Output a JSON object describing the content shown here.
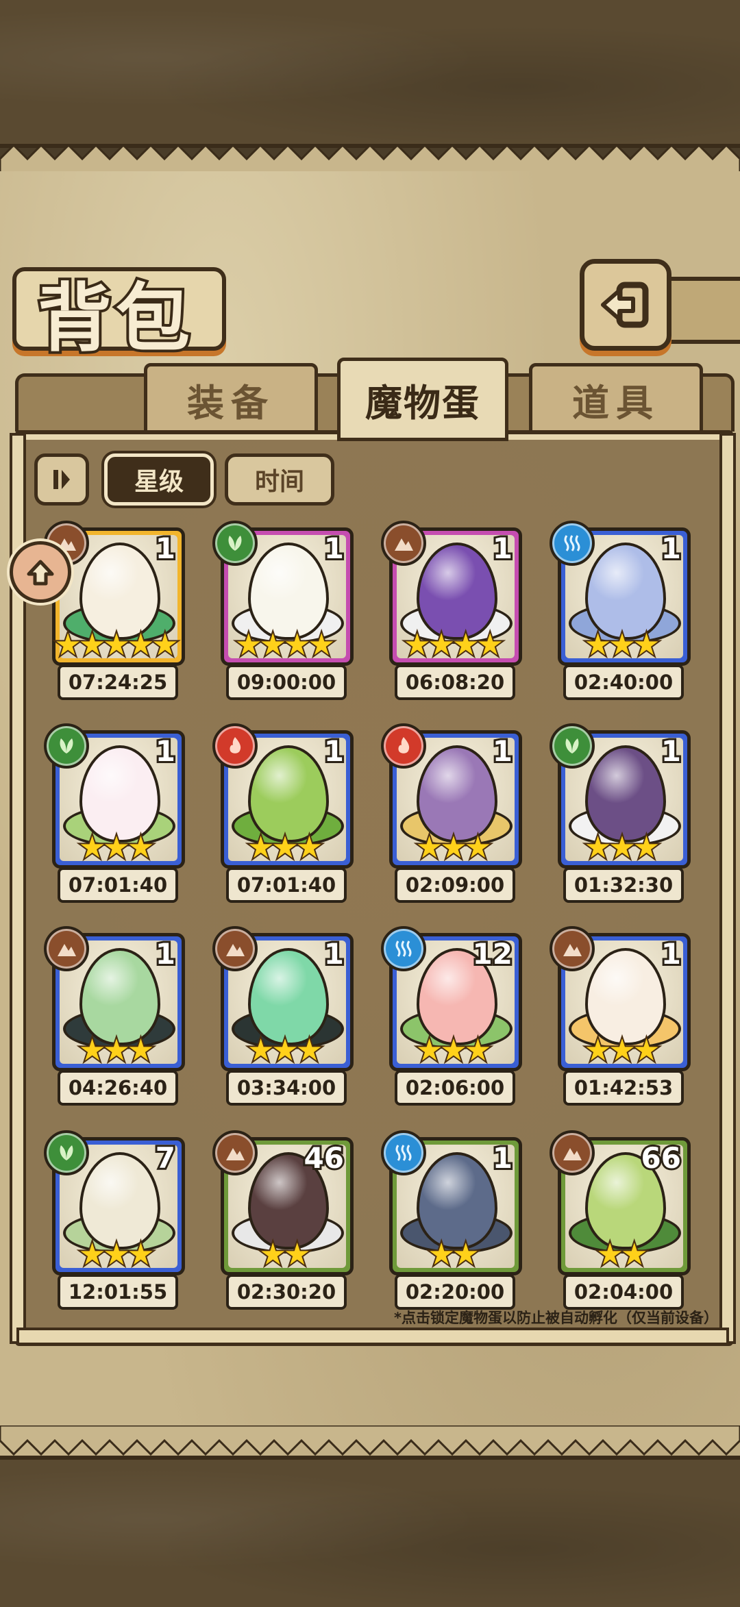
{
  "title": "背包",
  "tabs": [
    {
      "label": "装备",
      "active": false
    },
    {
      "label": "魔物蛋",
      "active": true
    },
    {
      "label": "道具",
      "active": false
    }
  ],
  "sort": {
    "toggle_icon": "pause-sort-icon",
    "star_label": "星级",
    "time_label": "时间",
    "active": "星级"
  },
  "hint": "*点击锁定魔物蛋以防止被自动孵化（仅当前设备）",
  "colors": {
    "gold": "#f2b52c",
    "purple": "#c54db0",
    "blue": "#3a5fd4",
    "green": "#6f9a3a",
    "earth": "#8a4e2c",
    "nature": "#3e8f3a",
    "water": "#2b8fd6",
    "fire": "#d23a2a"
  },
  "eggs": [
    {
      "count": "1",
      "stars": "★★★★★",
      "timer": "07:24:25",
      "element": "earth-icon",
      "rarity": "gold",
      "egg_color": "#f6efe0",
      "base_color": "#4fae6b",
      "locked": true
    },
    {
      "count": "1",
      "stars": "★★★★",
      "timer": "09:00:00",
      "element": "nature-icon",
      "rarity": "purple",
      "egg_color": "#f8f6ec",
      "base_color": "#f0f0f0"
    },
    {
      "count": "1",
      "stars": "★★★★",
      "timer": "06:08:20",
      "element": "earth-icon",
      "rarity": "purple",
      "egg_color": "#7a4fb0",
      "base_color": "#f0f0f0"
    },
    {
      "count": "1",
      "stars": "★★★",
      "timer": "02:40:00",
      "element": "water-icon",
      "rarity": "blue",
      "egg_color": "#aebde8",
      "base_color": "#8fa6d9"
    },
    {
      "count": "1",
      "stars": "★★★",
      "timer": "07:01:40",
      "element": "nature-icon",
      "rarity": "blue",
      "egg_color": "#fbeef2",
      "base_color": "#a9d27a"
    },
    {
      "count": "1",
      "stars": "★★★",
      "timer": "07:01:40",
      "element": "fire-icon",
      "rarity": "blue",
      "egg_color": "#9ccc5c",
      "base_color": "#6fae3e"
    },
    {
      "count": "1",
      "stars": "★★★",
      "timer": "02:09:00",
      "element": "fire-icon",
      "rarity": "blue",
      "egg_color": "#9a78b6",
      "base_color": "#e8c66a"
    },
    {
      "count": "1",
      "stars": "★★★",
      "timer": "01:32:30",
      "element": "nature-icon",
      "rarity": "blue",
      "egg_color": "#6c4f86",
      "base_color": "#f2f2f2"
    },
    {
      "count": "1",
      "stars": "★★★",
      "timer": "04:26:40",
      "element": "earth-icon",
      "rarity": "blue",
      "egg_color": "#a8d8a0",
      "base_color": "#2f3b3b"
    },
    {
      "count": "1",
      "stars": "★★★",
      "timer": "03:34:00",
      "element": "earth-icon",
      "rarity": "blue",
      "egg_color": "#7fd8a8",
      "base_color": "#2b3533"
    },
    {
      "count": "12",
      "stars": "★★★",
      "timer": "02:06:00",
      "element": "water-icon",
      "rarity": "blue",
      "egg_color": "#f6b7b2",
      "base_color": "#8cc46a"
    },
    {
      "count": "1",
      "stars": "★★★",
      "timer": "01:42:53",
      "element": "earth-icon",
      "rarity": "blue",
      "egg_color": "#f8eee2",
      "base_color": "#f4c56a"
    },
    {
      "count": "7",
      "stars": "★★★",
      "timer": "12:01:55",
      "element": "nature-icon",
      "rarity": "blue",
      "egg_color": "#efe9d6",
      "base_color": "#b6d39a"
    },
    {
      "count": "46",
      "stars": "★★",
      "timer": "02:30:20",
      "element": "earth-icon",
      "rarity": "green",
      "egg_color": "#5a4040",
      "base_color": "#e8e8e8"
    },
    {
      "count": "1",
      "stars": "★★",
      "timer": "02:20:00",
      "element": "water-icon",
      "rarity": "green",
      "egg_color": "#5d6b8a",
      "base_color": "#4a566e"
    },
    {
      "count": "66",
      "stars": "★★",
      "timer": "02:04:00",
      "element": "earth-icon",
      "rarity": "green",
      "egg_color": "#b9d77a",
      "base_color": "#4f8b3a"
    }
  ]
}
